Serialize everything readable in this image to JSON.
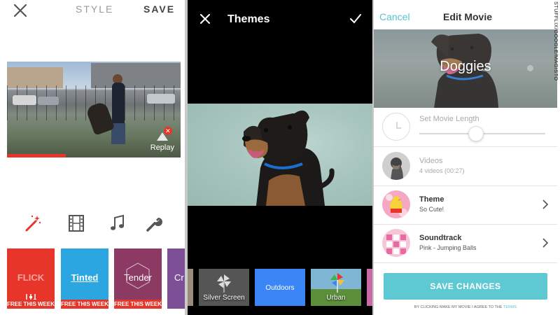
{
  "panel1": {
    "header": {
      "style_label": "STYLE",
      "save_label": "SAVE"
    },
    "replay_label": "Replay",
    "playback_progress": 0.34,
    "tools": [
      "magic-wand-icon",
      "film-icon",
      "music-note-icon",
      "wrench-icon"
    ],
    "styles": [
      {
        "name": "FLICK",
        "badge": "FREE THIS WEEK",
        "color": "#e8352a"
      },
      {
        "name": "Tinted",
        "badge": "FREE THIS WEEK",
        "color": "#2ba6e0"
      },
      {
        "name": "Tender",
        "badge": "FREE THIS WEEK",
        "color": "#8c3a63"
      },
      {
        "name": "Cr",
        "badge": "",
        "color": "#7d4f96"
      }
    ]
  },
  "panel2": {
    "title": "Themes",
    "themes": [
      {
        "label": "Silver Screen",
        "color": "#555555"
      },
      {
        "label": "Outdoors",
        "color": "#3b86f7"
      },
      {
        "label": "Urban",
        "color": "#7fb6d4"
      }
    ]
  },
  "panel3": {
    "cancel_label": "Cancel",
    "title": "Edit Movie",
    "movie_title": "Doggies",
    "length": {
      "label": "Set Movie Length",
      "value": 0.45
    },
    "videos": {
      "title": "Videos",
      "subtitle": "4 videos (00:27)"
    },
    "theme": {
      "title": "Theme",
      "subtitle": "So Cute!"
    },
    "soundtrack": {
      "title": "Soundtrack",
      "subtitle": "Pink - Jumping Balls"
    },
    "save_button": "SAVE CHANGES",
    "terms_text": "BY CLICKING MAKE MY MOVIE I AGREE TO THE",
    "terms_link": "TERMS"
  },
  "credit": "STUFFLIX/GOOGLE/MAGISTO",
  "colors": {
    "accent_red": "#e8352a",
    "accent_teal": "#5fc9d3"
  }
}
